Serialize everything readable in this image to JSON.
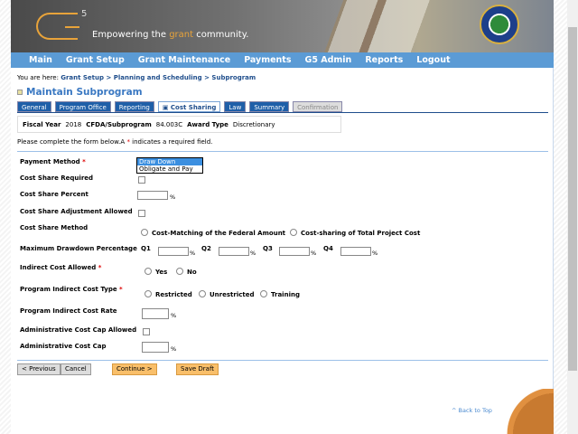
{
  "header": {
    "tagline_pre": "Empowering the ",
    "tagline_accent": "grant",
    "tagline_post": " community.",
    "logo": "G",
    "logo_sup": "5"
  },
  "nav": [
    "Main",
    "Grant Setup",
    "Grant Maintenance",
    "Payments",
    "G5 Admin",
    "Reports",
    "Logout"
  ],
  "breadcrumb": {
    "prefix": "You are here:",
    "items": "Grant Setup > Planning and Scheduling > Subprogram"
  },
  "page_title": "Maintain Subprogram",
  "tabs": [
    {
      "label": "General"
    },
    {
      "label": "Program Office"
    },
    {
      "label": "Reporting"
    },
    {
      "label": "Cost Sharing",
      "active": true
    },
    {
      "label": "Law"
    },
    {
      "label": "Summary"
    },
    {
      "label": "Confirmation",
      "disabled": true
    }
  ],
  "info": {
    "fy_label": "Fiscal Year",
    "fy": "2018",
    "cfda_label": "CFDA/Subprogram",
    "cfda": "84.003C",
    "award_label": "Award Type",
    "award": "Discretionary"
  },
  "instructions": {
    "pre": "Please complete the form below.A",
    "star": "*",
    "post": "indicates a required field."
  },
  "form": {
    "payment_method": {
      "label": "Payment Method",
      "options": [
        "Draw Down",
        "Obligate and Pay"
      ],
      "highlighted": "Draw Down"
    },
    "cost_share_required": {
      "label": "Cost Share Required",
      "checked": false
    },
    "cost_share_percent": {
      "label": "Cost Share Percent",
      "value": "",
      "unit": "%"
    },
    "cost_share_adjustment": {
      "label": "Cost Share Adjustment Allowed",
      "checked": false
    },
    "cost_share_method": {
      "label": "Cost Share Method",
      "options": [
        "Cost-Matching of the Federal Amount",
        "Cost-sharing of Total Project Cost"
      ]
    },
    "max_drawdown": {
      "label": "Maximum Drawdown Percentage",
      "quarters": [
        "Q1",
        "Q2",
        "Q3",
        "Q4"
      ],
      "unit": "%"
    },
    "indirect_allowed": {
      "label": "Indirect Cost Allowed",
      "options": [
        "Yes",
        "No"
      ]
    },
    "indirect_type": {
      "label": "Program Indirect Cost Type",
      "options": [
        "Restricted",
        "Unrestricted",
        "Training"
      ]
    },
    "indirect_rate": {
      "label": "Program Indirect Cost Rate",
      "unit": "%"
    },
    "admin_cap_allowed": {
      "label": "Administrative Cost Cap Allowed",
      "checked": false
    },
    "admin_cap": {
      "label": "Administrative Cost Cap",
      "unit": "%"
    }
  },
  "buttons": {
    "previous": "< Previous",
    "cancel": "Cancel",
    "continue": "Continue >",
    "save": "Save Draft"
  },
  "back_to_top": "^ Back to Top",
  "colors": {
    "nav": "#5b9bd5",
    "tab": "#1f5fa8",
    "accent": "#e8a33a",
    "button_primary": "#f9bf6a"
  }
}
